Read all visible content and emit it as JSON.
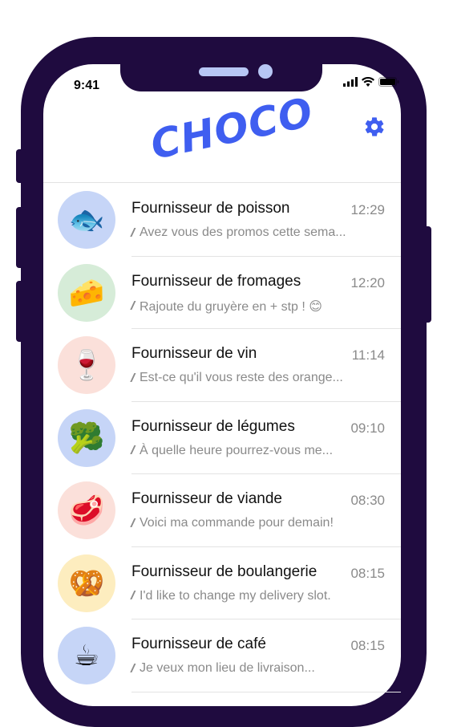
{
  "status_bar": {
    "time": "9:41"
  },
  "header": {
    "logo": "CHOCO"
  },
  "colors": {
    "phone_frame": "#1f0b3f",
    "brand": "#3f5ef0",
    "avatar_blue": "#c6d5f7",
    "avatar_green": "#d6ecd8",
    "avatar_pink": "#fbe0da",
    "avatar_yellow": "#fdedbf"
  },
  "chats": [
    {
      "name": "Fournisseur de poisson",
      "time": "12:29",
      "preview": "Avez vous des promos cette sema...",
      "emoji": "🐟",
      "icon": "fish-icon",
      "avatar_color": "#c6d5f7"
    },
    {
      "name": "Fournisseur de fromages",
      "time": "12:20",
      "preview": "Rajoute du gruyère en + stp ! 😊",
      "emoji": "🧀",
      "icon": "cheese-icon",
      "avatar_color": "#d6ecd8"
    },
    {
      "name": "Fournisseur de vin",
      "time": "11:14",
      "preview": "Est-ce qu'il vous reste des orange...",
      "emoji": "🍷",
      "icon": "wine-icon",
      "avatar_color": "#fbe0da"
    },
    {
      "name": "Fournisseur de légumes",
      "time": "09:10",
      "preview": "À quelle heure pourrez-vous me...",
      "emoji": "🥦",
      "icon": "broccoli-icon",
      "avatar_color": "#c6d5f7"
    },
    {
      "name": "Fournisseur de viande",
      "time": "08:30",
      "preview": "Voici ma commande pour demain!",
      "emoji": "🥩",
      "icon": "meat-icon",
      "avatar_color": "#fbe0da"
    },
    {
      "name": "Fournisseur de boulangerie",
      "time": "08:15",
      "preview": "I'd like to change my delivery slot.",
      "emoji": "🥨",
      "icon": "pretzel-icon",
      "avatar_color": "#fdedbf"
    },
    {
      "name": "Fournisseur de café",
      "time": "08:15",
      "preview": "Je veux mon lieu de livraison...",
      "emoji": "☕",
      "icon": "coffee-icon",
      "avatar_color": "#c6d5f7"
    }
  ]
}
